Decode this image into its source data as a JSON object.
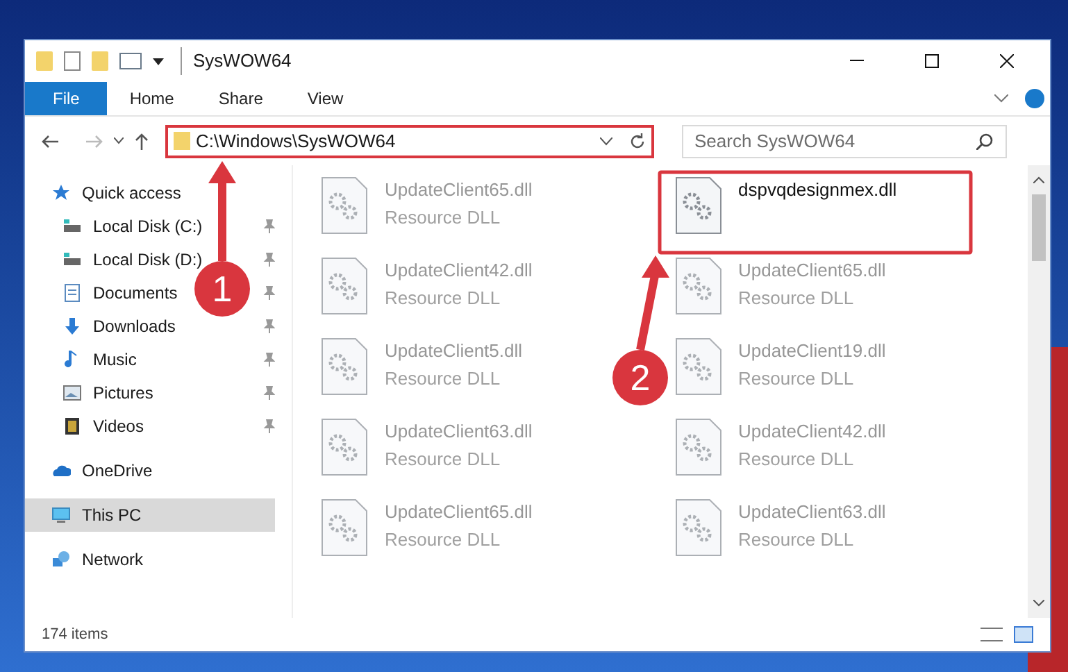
{
  "window": {
    "title": "SysWOW64"
  },
  "ribbon_tabs": [
    {
      "label": "File",
      "selected": true
    },
    {
      "label": "Home",
      "selected": false
    },
    {
      "label": "Share",
      "selected": false
    },
    {
      "label": "View",
      "selected": false
    }
  ],
  "address": {
    "path": "C:\\Windows\\SysWOW64"
  },
  "search": {
    "placeholder": "Search SysWOW64"
  },
  "sidebar": {
    "items": [
      {
        "label": "Quick access",
        "selected": false,
        "children": [
          {
            "label": "Local Disk (C:)",
            "pinned": true,
            "selected": false
          },
          {
            "label": "Local Disk (D:)",
            "pinned": true,
            "selected": false
          },
          {
            "label": "Documents",
            "pinned": true,
            "selected": false
          },
          {
            "label": "Downloads",
            "pinned": true,
            "selected": false
          },
          {
            "label": "Music",
            "pinned": true,
            "selected": false
          },
          {
            "label": "Pictures",
            "pinned": true,
            "selected": false
          },
          {
            "label": "Videos",
            "pinned": true,
            "selected": false
          }
        ]
      },
      {
        "label": "OneDrive",
        "selected": false
      },
      {
        "label": "This PC",
        "selected": true
      },
      {
        "label": "Network",
        "selected": false
      }
    ]
  },
  "files": [
    {
      "name": "UpdateClient65.dll",
      "type": "Resource DLL",
      "blurred": true
    },
    {
      "name": "dspvqdesignmex.dll",
      "blurred": false
    },
    {
      "name": "UpdateClient42.dll",
      "type": "Resource DLL",
      "blurred": true
    },
    {
      "name": "UpdateClient65.dll",
      "type": "Resource DLL",
      "blurred": true
    },
    {
      "name": "UpdateClient5.dll",
      "type": "Resource DLL",
      "blurred": true
    },
    {
      "name": "UpdateClient19.dll",
      "type": "Resource DLL",
      "blurred": true
    },
    {
      "name": "UpdateClient63.dll",
      "type": "Resource DLL",
      "blurred": true
    },
    {
      "name": "UpdateClient42.dll",
      "type": "Resource DLL",
      "blurred": true
    },
    {
      "name": "UpdateClient65.dll",
      "type": "Resource DLL",
      "blurred": true
    },
    {
      "name": "UpdateClient63.dll",
      "type": "Resource DLL",
      "blurred": true
    }
  ],
  "status_bar": {
    "count": "174 items"
  },
  "annotations": [
    {
      "number": "1"
    },
    {
      "number": "2"
    }
  ]
}
